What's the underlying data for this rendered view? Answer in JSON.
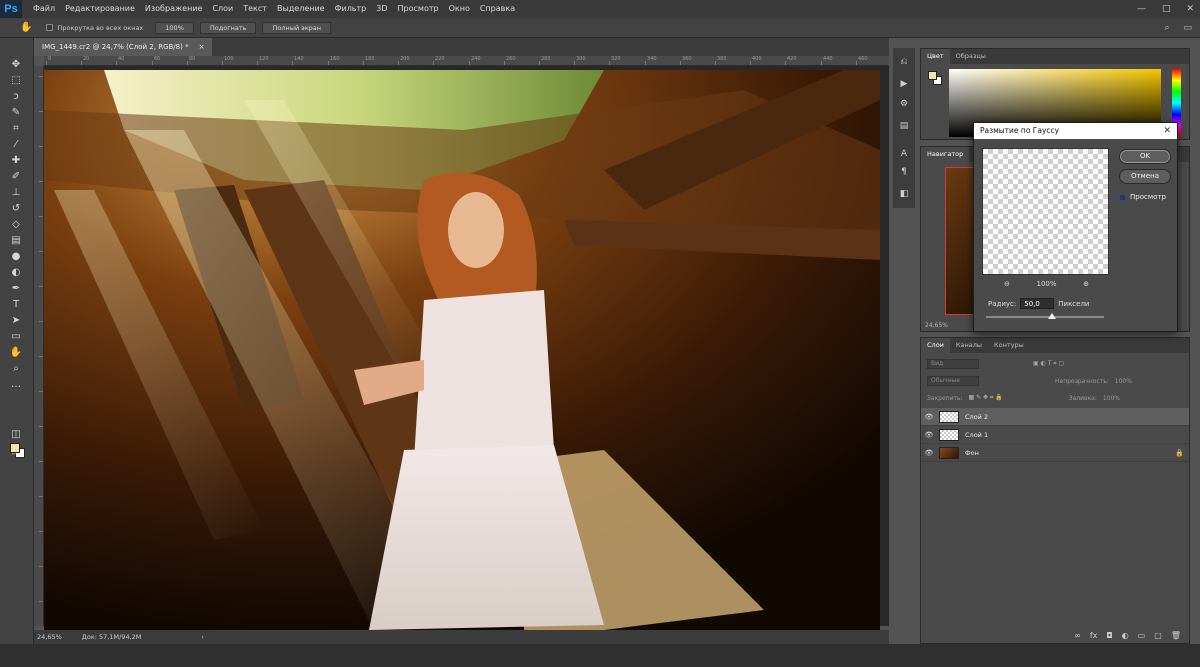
{
  "app": {
    "logo": "Ps"
  },
  "menu": [
    "Файл",
    "Редактирование",
    "Изображение",
    "Слои",
    "Текст",
    "Выделение",
    "Фильтр",
    "3D",
    "Просмотр",
    "Окно",
    "Справка"
  ],
  "window_controls": [
    "—",
    "□",
    "✕"
  ],
  "options_bar": {
    "scroll_all": "Прокрутка во всех окнах",
    "zoom_btn": "100%",
    "fit_btn": "Подогнать",
    "fullscreen_btn": "Полный экран"
  },
  "document": {
    "tab_title": "IMG_1449.cr2 @ 24,7% (Слой 2, RGB/8) *",
    "tab_close": "×",
    "ruler_labels": [
      "0",
      "20",
      "40",
      "60",
      "80",
      "100",
      "120",
      "140",
      "160",
      "180",
      "200",
      "220",
      "240",
      "260",
      "280",
      "300",
      "320",
      "340",
      "360",
      "380",
      "400",
      "420",
      "440",
      "460"
    ],
    "status_zoom": "24,65%",
    "status_doc": "Док: 57,1M/94,2M"
  },
  "panels": {
    "color_tabs": [
      "Цвет",
      "Образцы"
    ],
    "navigator_tabs": [
      "Навигатор",
      "Ог"
    ],
    "navigator_zoom": "24,65%",
    "layers_tabs": [
      "Слои",
      "Каналы",
      "Контуры"
    ],
    "layers_filter": "Вид",
    "blend_mode": "Обычные",
    "opacity_label": "Непрозрачность:",
    "opacity_value": "100%",
    "lock_label": "Закрепить:",
    "fill_label": "Заливка:",
    "fill_value": "100%"
  },
  "layers": [
    {
      "name": "Слой 2",
      "selected": true,
      "locked": false
    },
    {
      "name": "Слой 1",
      "selected": false,
      "locked": false
    },
    {
      "name": "Фон",
      "selected": false,
      "locked": true
    }
  ],
  "dialog": {
    "title": "Размытие по Гауссу",
    "ok": "OK",
    "cancel": "Отмена",
    "preview_label": "Просмотр",
    "zoom_value": "100%",
    "radius_label": "Радиус:",
    "radius_value": "50,0",
    "radius_unit": "Пиксели"
  },
  "colors": {
    "foreground": "#f0e6a8",
    "background": "#ffffff",
    "accent": "#31a8ff"
  }
}
